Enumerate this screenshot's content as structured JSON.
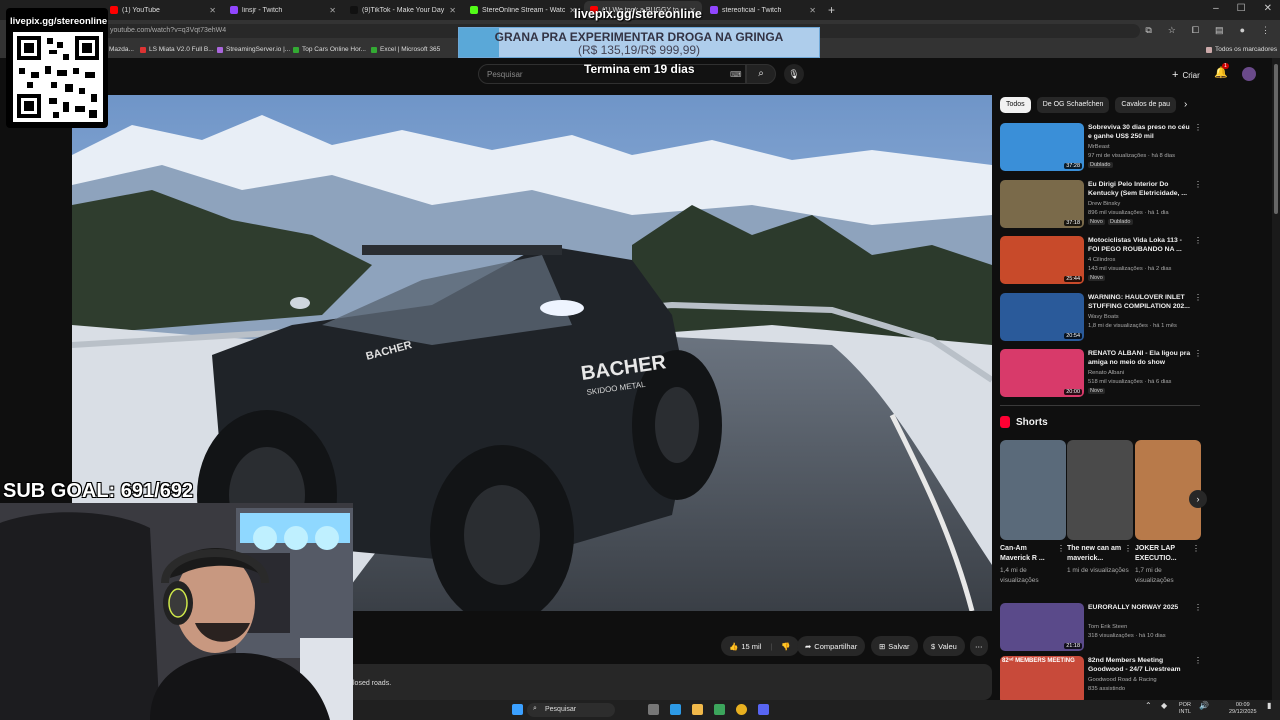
{
  "browser": {
    "tabs": [
      {
        "label": "(1) YouTube",
        "color": "#ff0000"
      },
      {
        "label": "linsjr - Twitch",
        "color": "#9146ff"
      },
      {
        "label": "(9)TikTok - Make Your Day",
        "color": "#111111"
      },
      {
        "label": "StereOnline Stream - Watch Li...",
        "color": "#53fc18"
      },
      {
        "label": "(1) We took a BUGGY to...",
        "color": "#ff0000",
        "active": true
      },
      {
        "label": "stereoficial - Twitch",
        "color": "#9146ff"
      }
    ],
    "url": "youtube.com/watch?v=q3Vqt73ehW4",
    "bookmarks": [
      {
        "label": "Mazda...",
        "color": "#d33"
      },
      {
        "label": "LS Miata V2.0 Full B...",
        "color": "#d33"
      },
      {
        "label": "StreamingServer.io |...",
        "color": "#a6d"
      },
      {
        "label": "Top Cars Online Hor...",
        "color": "#3a3"
      },
      {
        "label": "Excel | Microsoft 365",
        "color": "#3a3"
      }
    ],
    "bookmarks_right": "Todos os marcadores"
  },
  "youtube": {
    "search_placeholder": "Pesquisar",
    "create_label": "Criar",
    "notif_count": "1",
    "actions": {
      "likes": "15 mil",
      "share": "Compartilhar",
      "save": "Salvar",
      "thanks": "Valeu"
    },
    "description_snippet": "losed roads.",
    "chips": [
      "Todos",
      "De OG Schaefchen",
      "Cavalos de pau"
    ],
    "recommendations": [
      {
        "title": "Sobreviva 30 dias preso no céu e ganhe US$ 250 mil",
        "channel": "MrBeast",
        "meta": "97 mi de visualizações · há 8 dias",
        "duration": "37:28",
        "tags": [
          "Dublado"
        ],
        "thumb_color": "#3a8fd8"
      },
      {
        "title": "Eu Dirigi Pelo Interior Do Kentucky (Sem Eletricidade, ...",
        "channel": "Drew Binsky",
        "meta": "896 mil visualizações · há 1 dia",
        "duration": "37:18",
        "tags": [
          "Novo",
          "Dublado"
        ],
        "thumb_color": "#7a6a4a"
      },
      {
        "title": "Motociclistas Vida Loka 113 - FOI PEGO ROUBANDO NA ...",
        "channel": "4 Cilindros",
        "meta": "143 mil visualizações · há 2 dias",
        "duration": "25:44",
        "tags": [
          "Novo"
        ],
        "thumb_color": "#c84a2a"
      },
      {
        "title": "WARNING: HAULOVER INLET STUFFING COMPILATION 202...",
        "channel": "Wavy Boats",
        "meta": "1,8 mi de visualizações · há 1 mês",
        "duration": "20:54",
        "tags": [],
        "thumb_color": "#2a5a9a"
      },
      {
        "title": "RENATO ALBANI - Ela ligou pra amiga no meio do show",
        "channel": "Renato Albani",
        "meta": "518 mil visualizações · há 6 dias",
        "duration": "20:00",
        "tags": [
          "Novo"
        ],
        "thumb_color": "#d83a6a"
      }
    ],
    "shorts_title": "Shorts",
    "shorts": [
      {
        "title": "Can-Am Maverick R ...",
        "meta": "1,4 mi de visualizações",
        "thumb_color": "#5a6a7a"
      },
      {
        "title": "The new can am maverick...",
        "meta": "1 mi de visualizações",
        "thumb_color": "#4a4a4a"
      },
      {
        "title": "JOKER LAP EXECUTIO...",
        "meta": "1,7 mi de visualizações",
        "thumb_color": "#b87a4a"
      }
    ],
    "recommendations2": [
      {
        "title": "EURORALLY NORWAY 2025",
        "channel": "Tom Erik Steen",
        "meta": "318 visualizações · há 10 dias",
        "duration": "21:18",
        "thumb_color": "#5a4a8a"
      },
      {
        "title": "82nd Members Meeting Goodwood - 24/7 Livestream",
        "channel": "Goodwood Road & Racing",
        "meta": "835 assistindo",
        "duration": "",
        "thumb_color": "#c84a3a",
        "overlay": "82ⁿᵈ MEMBERS MEETING"
      }
    ]
  },
  "overlay": {
    "qr_label": "livepix.gg/stereonline",
    "top_label": "livepix.gg/stereonline",
    "banner_line1": "GRANA PRA EXPERIMENTAR DROGA NA GRINGA",
    "banner_line2": "(R$ 135,19/R$ 999,99)",
    "termina": "Termina em 19 dias",
    "sub_goal": "SUB GOAL: 691/692",
    "video_text1": "BACHER",
    "video_text2": "SKIDOO METAL"
  },
  "taskbar": {
    "search_label": "Pesquisar",
    "lang_top": "POR",
    "lang_bottom": "INTL",
    "time": "00:09",
    "date": "29/12/2025"
  }
}
